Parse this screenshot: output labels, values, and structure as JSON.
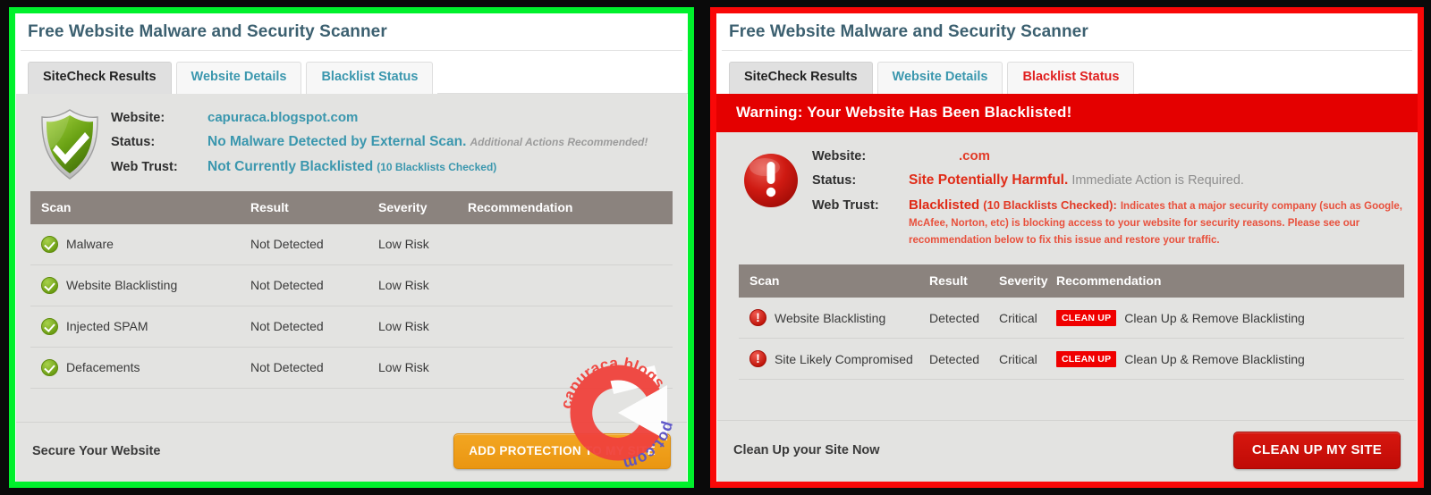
{
  "colors": {
    "left_border": "#00f12c",
    "right_border": "#f90808",
    "title": "#3c6070",
    "link_blue": "#3b97ae",
    "danger_red": "#e02a16",
    "warning_bar": "#e40000",
    "table_header": "#8b837e",
    "button_orange": "#ea9612",
    "button_red": "#c00b06",
    "page_bg": "#000000"
  },
  "left_panel": {
    "title": "Free Website Malware and Security Scanner",
    "tabs": [
      {
        "label": "SiteCheck Results",
        "active": true,
        "style": "active"
      },
      {
        "label": "Website Details",
        "active": false,
        "style": "link"
      },
      {
        "label": "Blacklist Status",
        "active": false,
        "style": "link"
      }
    ],
    "status_icon": "green-shield-check-icon",
    "summary": {
      "website_label": "Website:",
      "website_value": "capuraca.blogspot.com",
      "status_label": "Status:",
      "status_value": "No Malware Detected by External Scan.",
      "status_note": "Additional Actions Recommended!",
      "webtrust_label": "Web Trust:",
      "webtrust_value": "Not Currently Blacklisted",
      "webtrust_note": "(10 Blacklists Checked)"
    },
    "table": {
      "headers": [
        "Scan",
        "Result",
        "Severity",
        "Recommendation"
      ],
      "rows": [
        {
          "icon": "green-check-icon",
          "scan": "Malware",
          "result": "Not Detected",
          "severity": "Low Risk",
          "recommendation": ""
        },
        {
          "icon": "green-check-icon",
          "scan": "Website Blacklisting",
          "result": "Not Detected",
          "severity": "Low Risk",
          "recommendation": ""
        },
        {
          "icon": "green-check-icon",
          "scan": "Injected SPAM",
          "result": "Not Detected",
          "severity": "Low Risk",
          "recommendation": ""
        },
        {
          "icon": "green-check-icon",
          "scan": "Defacements",
          "result": "Not Detected",
          "severity": "Low Risk",
          "recommendation": ""
        }
      ]
    },
    "footer": {
      "label": "Secure Your Website",
      "button": "ADD PROTECTION TO MY SITE"
    },
    "watermark": "capuraca.blogspot.com"
  },
  "right_panel": {
    "title": "Free Website Malware and Security Scanner",
    "tabs": [
      {
        "label": "SiteCheck Results",
        "active": true,
        "style": "active"
      },
      {
        "label": "Website Details",
        "active": false,
        "style": "link"
      },
      {
        "label": "Blacklist Status",
        "active": false,
        "style": "danger"
      }
    ],
    "warning_banner": "Warning: Your Website Has Been Blacklisted!",
    "status_icon": "red-exclamation-circle-icon",
    "summary": {
      "website_label": "Website:",
      "website_value": ".com",
      "status_label": "Status:",
      "status_value": "Site Potentially Harmful.",
      "status_note": "Immediate Action is Required.",
      "webtrust_label": "Web Trust:",
      "webtrust_value": "Blacklisted",
      "webtrust_note": "(10 Blacklists Checked):",
      "webtrust_description": "Indicates that a major security company (such as Google, McAfee, Norton, etc) is blocking access to your website for security reasons. Please see our recommendation below to fix this issue and restore your traffic."
    },
    "table": {
      "headers": [
        "Scan",
        "Result",
        "Severity",
        "Recommendation"
      ],
      "rows": [
        {
          "icon": "red-exclamation-icon",
          "scan": "Website Blacklisting",
          "result": "Detected",
          "severity": "Critical",
          "chip": "CLEAN UP",
          "recommendation": "Clean Up & Remove Blacklisting"
        },
        {
          "icon": "red-exclamation-icon",
          "scan": "Site Likely Compromised",
          "result": "Detected",
          "severity": "Critical",
          "chip": "CLEAN UP",
          "recommendation": "Clean Up & Remove Blacklisting"
        }
      ]
    },
    "footer": {
      "label": "Clean Up your Site Now",
      "button": "CLEAN UP MY SITE"
    }
  }
}
